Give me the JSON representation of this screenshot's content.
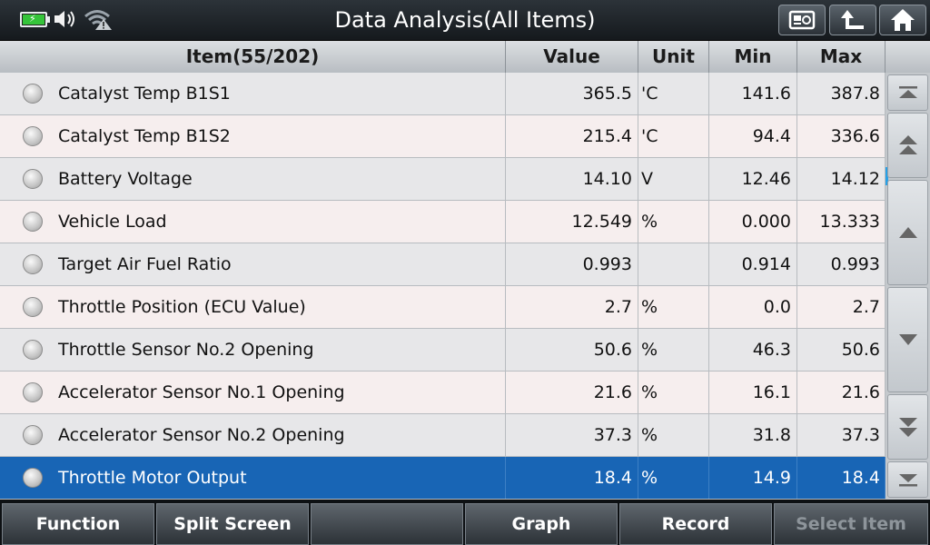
{
  "title": "Data Analysis(All Items)",
  "status_icons": [
    "battery-charging-icon",
    "speaker-icon",
    "wifi-warning-icon"
  ],
  "toolbar_icons": [
    "screenshot-icon",
    "back-icon",
    "home-icon"
  ],
  "columns": {
    "item": "Item(55/202)",
    "value": "Value",
    "unit": "Unit",
    "min": "Min",
    "max": "Max"
  },
  "rows": [
    {
      "item": "Catalyst Temp B1S1",
      "value": "365.5",
      "unit": "'C",
      "min": "141.6",
      "max": "387.8"
    },
    {
      "item": "Catalyst Temp B1S2",
      "value": "215.4",
      "unit": "'C",
      "min": "94.4",
      "max": "336.6"
    },
    {
      "item": "Battery Voltage",
      "value": "14.10",
      "unit": "V",
      "min": "12.46",
      "max": "14.12"
    },
    {
      "item": "Vehicle Load",
      "value": "12.549",
      "unit": "%",
      "min": "0.000",
      "max": "13.333"
    },
    {
      "item": "Target Air Fuel Ratio",
      "value": "0.993",
      "unit": "",
      "min": "0.914",
      "max": "0.993"
    },
    {
      "item": "Throttle Position (ECU Value)",
      "value": "2.7",
      "unit": "%",
      "min": "0.0",
      "max": "2.7"
    },
    {
      "item": "Throttle Sensor No.2 Opening",
      "value": "50.6",
      "unit": "%",
      "min": "46.3",
      "max": "50.6"
    },
    {
      "item": "Accelerator Sensor No.1 Opening",
      "value": "21.6",
      "unit": "%",
      "min": "16.1",
      "max": "21.6"
    },
    {
      "item": "Accelerator Sensor No.2 Opening",
      "value": "37.3",
      "unit": "%",
      "min": "31.8",
      "max": "37.3"
    },
    {
      "item": "Throttle Motor Output",
      "value": "18.4",
      "unit": "%",
      "min": "14.9",
      "max": "18.4"
    }
  ],
  "selected_row": 9,
  "bottom_buttons": {
    "function": "Function",
    "split_screen": "Split Screen",
    "blank": "",
    "graph": "Graph",
    "record": "Record",
    "select_item": "Select Item"
  },
  "colors": {
    "selected_row": "#1865b5",
    "accent": "#28a0e6",
    "battery": "#35c43a"
  }
}
